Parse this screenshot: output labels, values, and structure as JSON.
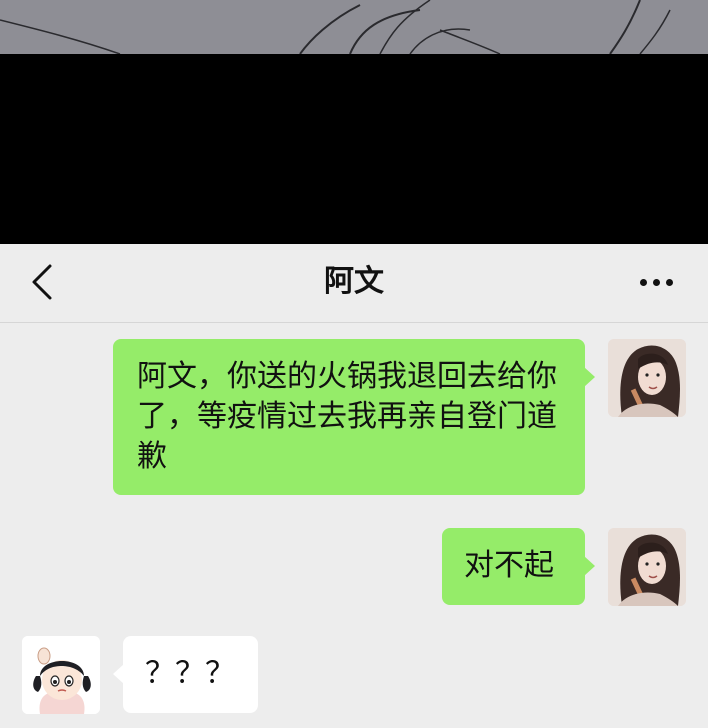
{
  "header": {
    "title": "阿文",
    "back_icon": "chevron-left-icon",
    "more_icon": "more-dots-icon"
  },
  "messages": [
    {
      "side": "right",
      "text": "阿文，你送的火锅我退回去给你了，等疫情过去我再亲自登门道歉"
    },
    {
      "side": "right",
      "text": "对不起"
    },
    {
      "side": "left",
      "text": "？？？"
    }
  ],
  "colors": {
    "sent_bubble": "#95ec69",
    "received_bubble": "#ffffff",
    "background": "#ededed"
  }
}
